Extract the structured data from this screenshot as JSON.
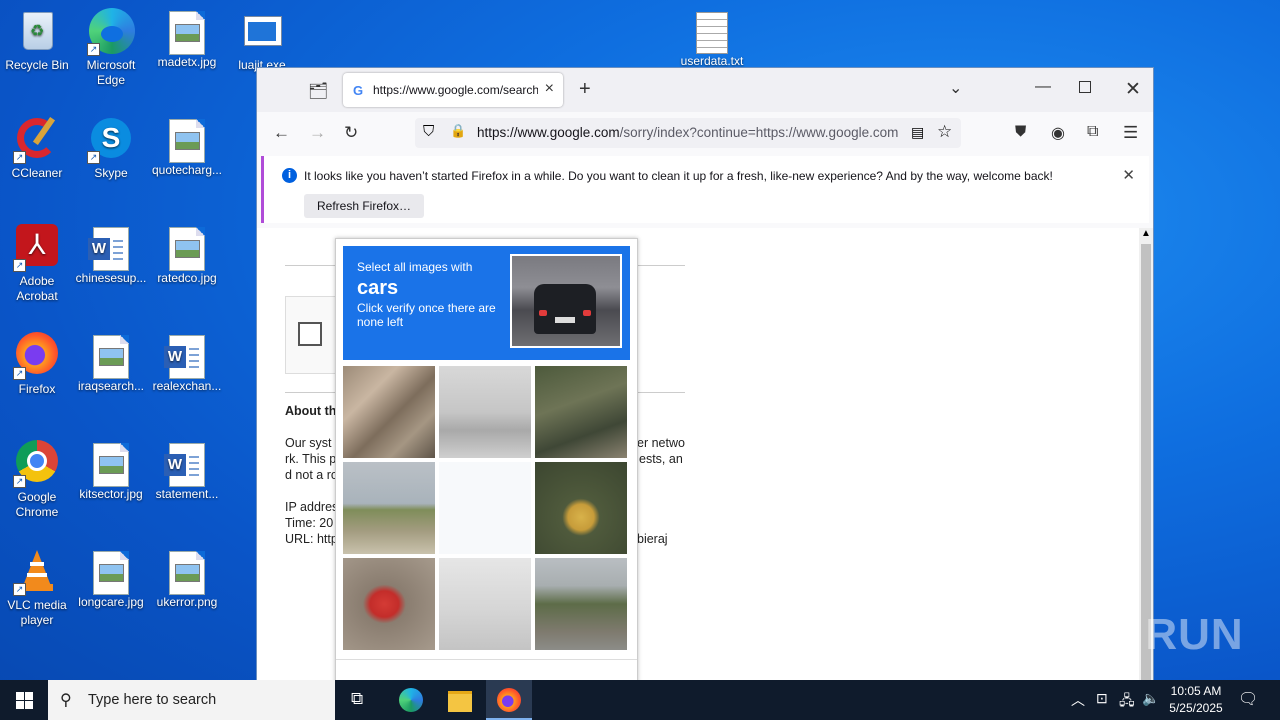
{
  "desktop": {
    "icons": [
      {
        "label": "Recycle Bin"
      },
      {
        "label": "Microsoft Edge"
      },
      {
        "label": "madetx.jpg"
      },
      {
        "label": "luajit.exe"
      },
      {
        "label": "userdata.txt"
      },
      {
        "label": "CCleaner"
      },
      {
        "label": "Skype"
      },
      {
        "label": "quotecharg..."
      },
      {
        "label": "Adobe Acrobat"
      },
      {
        "label": "chinesesup..."
      },
      {
        "label": "ratedco.jpg"
      },
      {
        "label": "Firefox"
      },
      {
        "label": "iraqsearch..."
      },
      {
        "label": "realexchan..."
      },
      {
        "label": "Google Chrome"
      },
      {
        "label": "kitsector.jpg"
      },
      {
        "label": "statement..."
      },
      {
        "label": "VLC media player"
      },
      {
        "label": "longcare.jpg"
      },
      {
        "label": "ukerror.png"
      }
    ]
  },
  "browser": {
    "tab_title": "https://www.google.com/search",
    "url_domain": "https://www.google.com",
    "url_rest": "/sorry/index?continue=https://www.google.com",
    "notification": {
      "message": "It looks like you haven’t started Firefox in a while. Do you want to clean it up for a fresh, like-new experience? And by the way, welcome back!",
      "button": "Refresh Firefox…"
    },
    "page": {
      "about_heading": "About th",
      "p1_l1": "Our syst",
      "p1_l1_right": "er netwo",
      "p1_l2": "rk. This p",
      "p1_l2_right": "ests, an",
      "p1_l3": "d not a ro",
      "ip": "IP addres",
      "time": "Time: 20",
      "url": "URL: http",
      "url_right": "bieraj"
    }
  },
  "captcha": {
    "instruction": "Select all images with",
    "target": "cars",
    "hint": "Click verify once there are none left"
  },
  "watermark": "ANY RUN",
  "taskbar": {
    "search_placeholder": "Type here to search",
    "time": "10:05 AM",
    "date": "5/25/2025"
  }
}
